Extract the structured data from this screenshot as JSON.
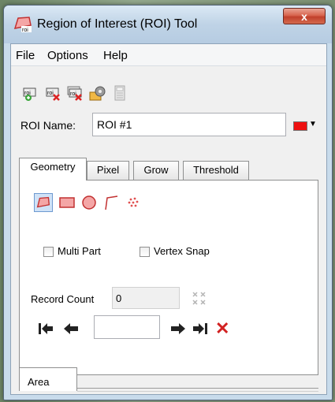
{
  "window": {
    "title": "Region of Interest (ROI) Tool",
    "close_glyph": "x"
  },
  "menu": {
    "items": [
      "File",
      "Options",
      "Help"
    ]
  },
  "toolbar": {
    "icons": [
      "new-roi-icon",
      "delete-roi-icon",
      "delete-all-roi-icon",
      "options-icon",
      "calculator-icon"
    ]
  },
  "roi": {
    "name_label": "ROI Name:",
    "name_value": "ROI #1",
    "color": "#ee1111"
  },
  "tabs": {
    "items": [
      "Geometry",
      "Pixel",
      "Grow",
      "Threshold"
    ],
    "active": "Geometry"
  },
  "geometry": {
    "tools": [
      "polygon-icon",
      "rectangle-icon",
      "ellipse-icon",
      "polyline-icon",
      "point-icon"
    ],
    "multi_part_label": "Multi Part",
    "vertex_snap_label": "Vertex Snap",
    "record_count_label": "Record Count",
    "record_count_value": "0",
    "record_value": "",
    "delete_glyph": "✕"
  },
  "bottom_tabs": {
    "items": [
      "Area"
    ]
  },
  "colors": {
    "accent_red": "#d22222",
    "titlebar": "#bfd3e6"
  }
}
